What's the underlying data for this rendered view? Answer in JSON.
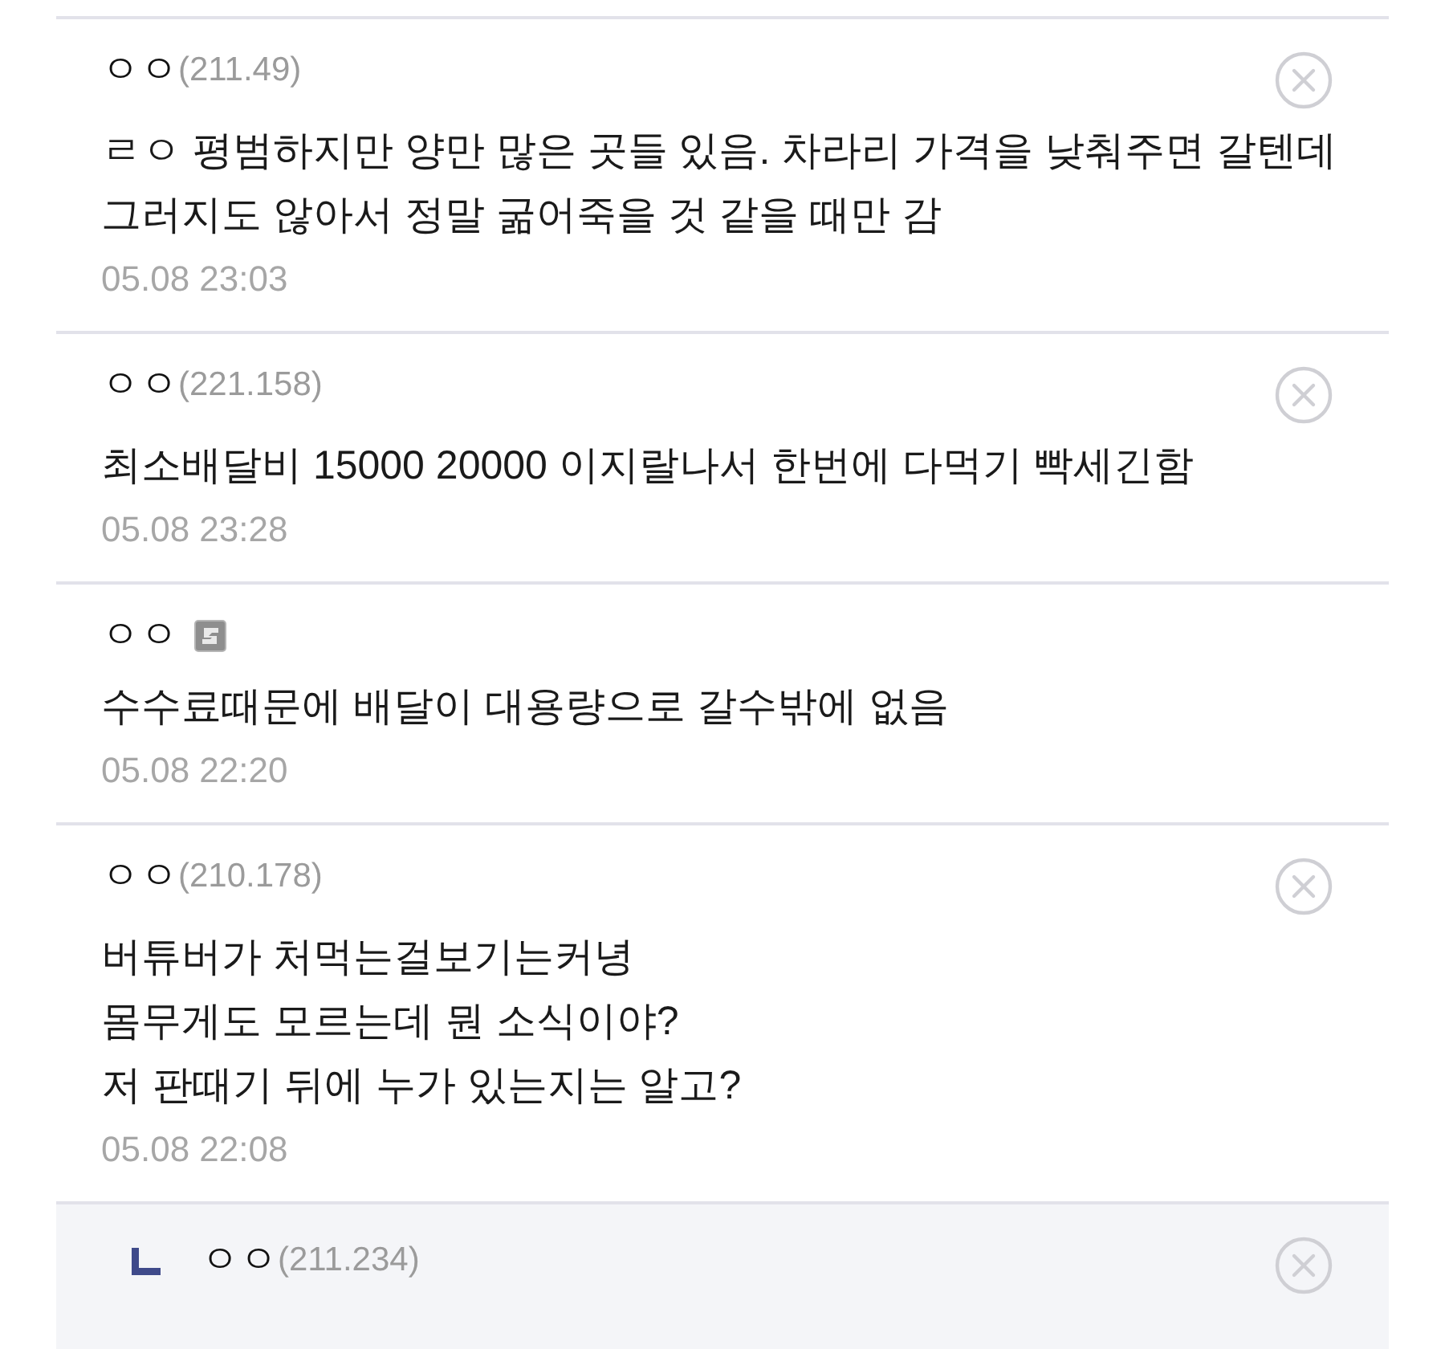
{
  "comments": [
    {
      "kind": "guest",
      "name": "ㅇㅇ",
      "ip": "(211.49)",
      "body": [
        "ㄹㅇ 평범하지만 양만 많은 곳들 있음. 차라리 가격을 낮춰주면 갈텐데",
        "그러지도 않아서 정말 굶어죽을 것 같을 때만 감"
      ],
      "date": "05.08 23:03",
      "deletable": true
    },
    {
      "kind": "guest",
      "name": "ㅇㅇ",
      "ip": "(221.158)",
      "body": [
        "최소배달비 15000 20000 이지랄나서 한번에 다먹기 빡세긴함"
      ],
      "date": "05.08 23:28",
      "deletable": true
    },
    {
      "kind": "member",
      "name": "ㅇㅇ",
      "body": [
        "수수료때문에 배달이 대용량으로 갈수밖에 없음"
      ],
      "date": "05.08 22:20",
      "deletable": false
    },
    {
      "kind": "guest",
      "name": "ㅇㅇ",
      "ip": "(210.178)",
      "body": [
        "버튜버가 처먹는걸보기는커녕",
        "몸무게도 모르는데 뭔 소식이야?",
        "저 판때기 뒤에 누가 있는지는 알고?"
      ],
      "date": "05.08 22:08",
      "deletable": true,
      "replies": [
        {
          "kind": "guest",
          "name": "ㅇㅇ",
          "ip": "(211.234)",
          "deletable": true
        }
      ]
    }
  ]
}
